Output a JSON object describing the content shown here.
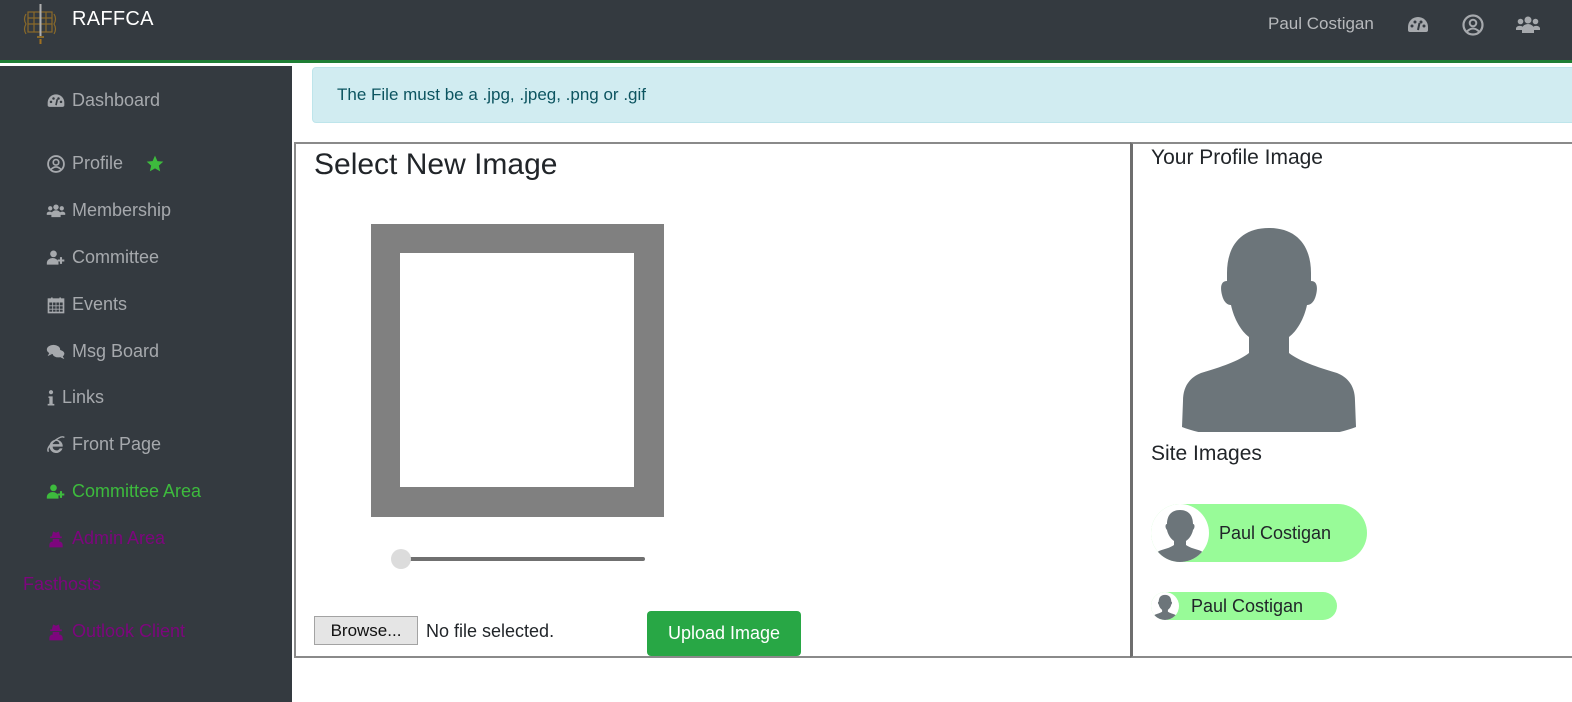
{
  "topbar": {
    "brand": "RAFFCA",
    "user_name": "Paul Costigan",
    "icons": [
      "dashboard-icon",
      "user-circle-icon",
      "users-icon"
    ],
    "accent_color": "#1e7e34"
  },
  "sidebar": {
    "items": [
      {
        "label": "Dashboard",
        "icon": "dashboard-icon"
      },
      {
        "label": "Profile",
        "icon": "user-circle-icon",
        "badge": "star-icon"
      },
      {
        "label": "Membership",
        "icon": "users-icon"
      },
      {
        "label": "Committee",
        "icon": "user-plus-icon"
      },
      {
        "label": "Events",
        "icon": "calendar-icon"
      },
      {
        "label": "Msg Board",
        "icon": "comments-icon"
      },
      {
        "label": "Links",
        "icon": "info-icon"
      },
      {
        "label": "Front Page",
        "icon": "internet-explorer-icon"
      },
      {
        "label": "Committee Area",
        "icon": "user-plus-icon",
        "color": "#3dbb3d"
      },
      {
        "label": "Admin Area",
        "icon": "user-secret-icon",
        "color": "#7d067d"
      }
    ],
    "section_label": "Fasthosts",
    "section_items": [
      {
        "label": "Outlook Client",
        "icon": "user-secret-icon",
        "color": "#7d067d"
      }
    ]
  },
  "alert": {
    "message": "The File must be a .jpg, .jpeg, .png or .gif"
  },
  "select_panel": {
    "title": "Select New Image",
    "zoom_slider_value": 0,
    "browse_label": "Browse...",
    "file_status": "No file selected.",
    "upload_label": "Upload Image"
  },
  "profile_panel": {
    "title": "Your Profile Image",
    "site_images_title": "Site Images",
    "chips": [
      {
        "name": "Paul Costigan",
        "size": "large"
      },
      {
        "name": "Paul Costigan",
        "size": "small"
      }
    ],
    "chip_color": "#98fb98"
  }
}
